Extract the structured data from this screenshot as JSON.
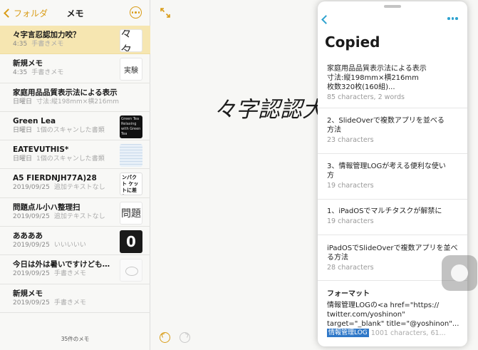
{
  "sidebar": {
    "back_label": "フォルダ",
    "title": "メモ",
    "footer": "35件のメモ",
    "notes": [
      {
        "title": "々字言忍認加力咬？",
        "date": "4:35",
        "sub": "手書きメモ",
        "thumb": "hand"
      },
      {
        "title": "新規メモ",
        "date": "4:35",
        "sub": "手書きメモ",
        "thumb": "hand2"
      },
      {
        "title": "家庭用品品質表示法による表示",
        "date": "日曜日",
        "sub": "寸法:縦198mm×横216mm",
        "thumb": "none"
      },
      {
        "title": "Green Lea",
        "date": "日曜日",
        "sub": "1個のスキャンした書類",
        "thumb": "dark"
      },
      {
        "title": "EATEVUTHIS*",
        "date": "日曜日",
        "sub": "1個のスキャンした書類",
        "thumb": "blue"
      },
      {
        "title": "A5 FIERDNJH77A)28",
        "date": "2019/09/25",
        "sub": "追加テキストなし",
        "thumb": "print"
      },
      {
        "title": "問題点ル小ハ整理扫",
        "date": "2019/09/25",
        "sub": "追加テキストなし",
        "thumb": "jp"
      },
      {
        "title": "ああああ",
        "date": "2019/09/25",
        "sub": "いいいいい",
        "thumb": "book"
      },
      {
        "title": "今日は外は暑いですけども…",
        "date": "2019/09/25",
        "sub": "手書きメモ",
        "thumb": "cat"
      },
      {
        "title": "新規メモ",
        "date": "2019/09/25",
        "sub": "手書きメモ",
        "thumb": "none"
      }
    ],
    "thumb_text": {
      "hand": "々夕",
      "hand2": "実験",
      "dark": "Green Tea Relaxing with Green Tea",
      "print": "ンパクト ケットに差し いい名筆",
      "jp": "問題",
      "book": "0"
    }
  },
  "canvas": {
    "handwriting": "々字認認大"
  },
  "slideover": {
    "title": "Copied",
    "clips": [
      {
        "lines": [
          "家庭用品品質表示法による表示",
          "寸法:縦198mm×横216mm",
          "枚数320枚(160組)..."
        ],
        "count": "85 characters, 2 words"
      },
      {
        "lines": [
          "2、SlideOverで複数アプリを並べる",
          "方法"
        ],
        "count": "23 characters"
      },
      {
        "lines": [
          "3、情報管理LOGが考える便利な使い",
          "方"
        ],
        "count": "19 characters"
      },
      {
        "lines": [
          "1、iPadOSでマルチタスクが解禁に"
        ],
        "count": "19 characters"
      },
      {
        "lines": [
          "iPadOSでSlideOverで複数アプリを並べ",
          "る方法"
        ],
        "count": "28 characters"
      }
    ],
    "format_clip": {
      "heading": "フォーマット",
      "lines": [
        "情報管理LOGの<a href=\"https://",
        "twitter.com/yoshinon\"",
        "target=\"_blank\" title=\"@yoshinon\"..."
      ],
      "badge": "情報管理LOG",
      "count": "1001 characters, 61..."
    }
  },
  "colors": {
    "accent": "#d99c17",
    "link_blue": "#2ea2cf",
    "selected_row": "#f6e6b1",
    "badge_blue": "#2f78c8"
  }
}
